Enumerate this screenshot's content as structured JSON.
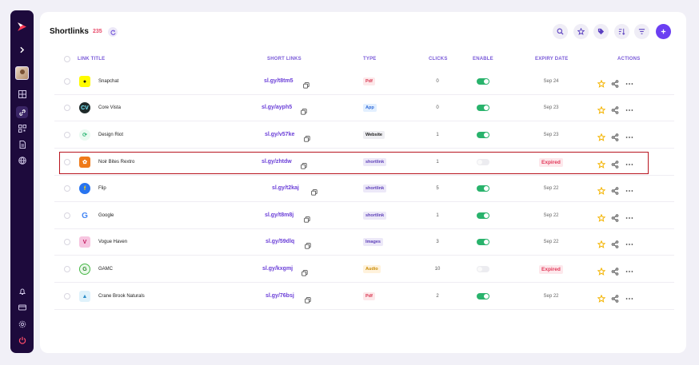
{
  "header": {
    "title": "Shortlinks",
    "count": "235"
  },
  "columns": {
    "title": "LINK TITLE",
    "short": "SHORT LINKS",
    "type": "TYPE",
    "clicks": "CLICKS",
    "enable": "ENABLE",
    "expiry": "EXPIRY DATE",
    "actions": "ACTIONS"
  },
  "colors": {
    "accent": "#6b3ff2",
    "sidebar": "#1d0a3c",
    "enabled": "#29b36c",
    "expired": "#e23a5a"
  },
  "rows": [
    {
      "name": "Snapchat",
      "short": "sl.gy/t8tm5",
      "type": "Pdf",
      "clicks": "0",
      "enabled": true,
      "expiry": "Sep 24",
      "logo": "snapchat-icon"
    },
    {
      "name": "Core Vista",
      "short": "sl.gy/ayph5",
      "type": "App",
      "clicks": "0",
      "enabled": true,
      "expiry": "Sep 23",
      "logo": "core-vista-icon"
    },
    {
      "name": "Design Riot",
      "short": "sl.gy/v57ke",
      "type": "Website",
      "clicks": "1",
      "enabled": true,
      "expiry": "Sep 23",
      "logo": "design-riot-icon"
    },
    {
      "name": "Noir Bites Rextro",
      "short": "sl.gy/zhtdw",
      "type": "shortlink",
      "clicks": "1",
      "enabled": false,
      "expiry": "Expired",
      "logo": "noir-bites-icon"
    },
    {
      "name": "Flip",
      "short": "sl.gy/t2kaj",
      "type": "shortlink",
      "clicks": "5",
      "enabled": true,
      "expiry": "Sep 22",
      "logo": "flip-icon"
    },
    {
      "name": "Google",
      "short": "sl.gy/t8m8j",
      "type": "shortlink",
      "clicks": "1",
      "enabled": true,
      "expiry": "Sep 22",
      "logo": "google-icon"
    },
    {
      "name": "Vogue Haven",
      "short": "sl.gy/59dlq",
      "type": "Images",
      "clicks": "3",
      "enabled": true,
      "expiry": "Sep 22",
      "logo": "vogue-haven-icon"
    },
    {
      "name": "GAMC",
      "short": "sl.gy/kxgmj",
      "type": "Audio",
      "clicks": "10",
      "enabled": false,
      "expiry": "Expired",
      "logo": "gamc-icon"
    },
    {
      "name": "Crane Brook Naturals",
      "short": "sl.gy/76bsj",
      "type": "Pdf",
      "clicks": "2",
      "enabled": true,
      "expiry": "Sep 22",
      "logo": "crane-brook-icon"
    }
  ]
}
